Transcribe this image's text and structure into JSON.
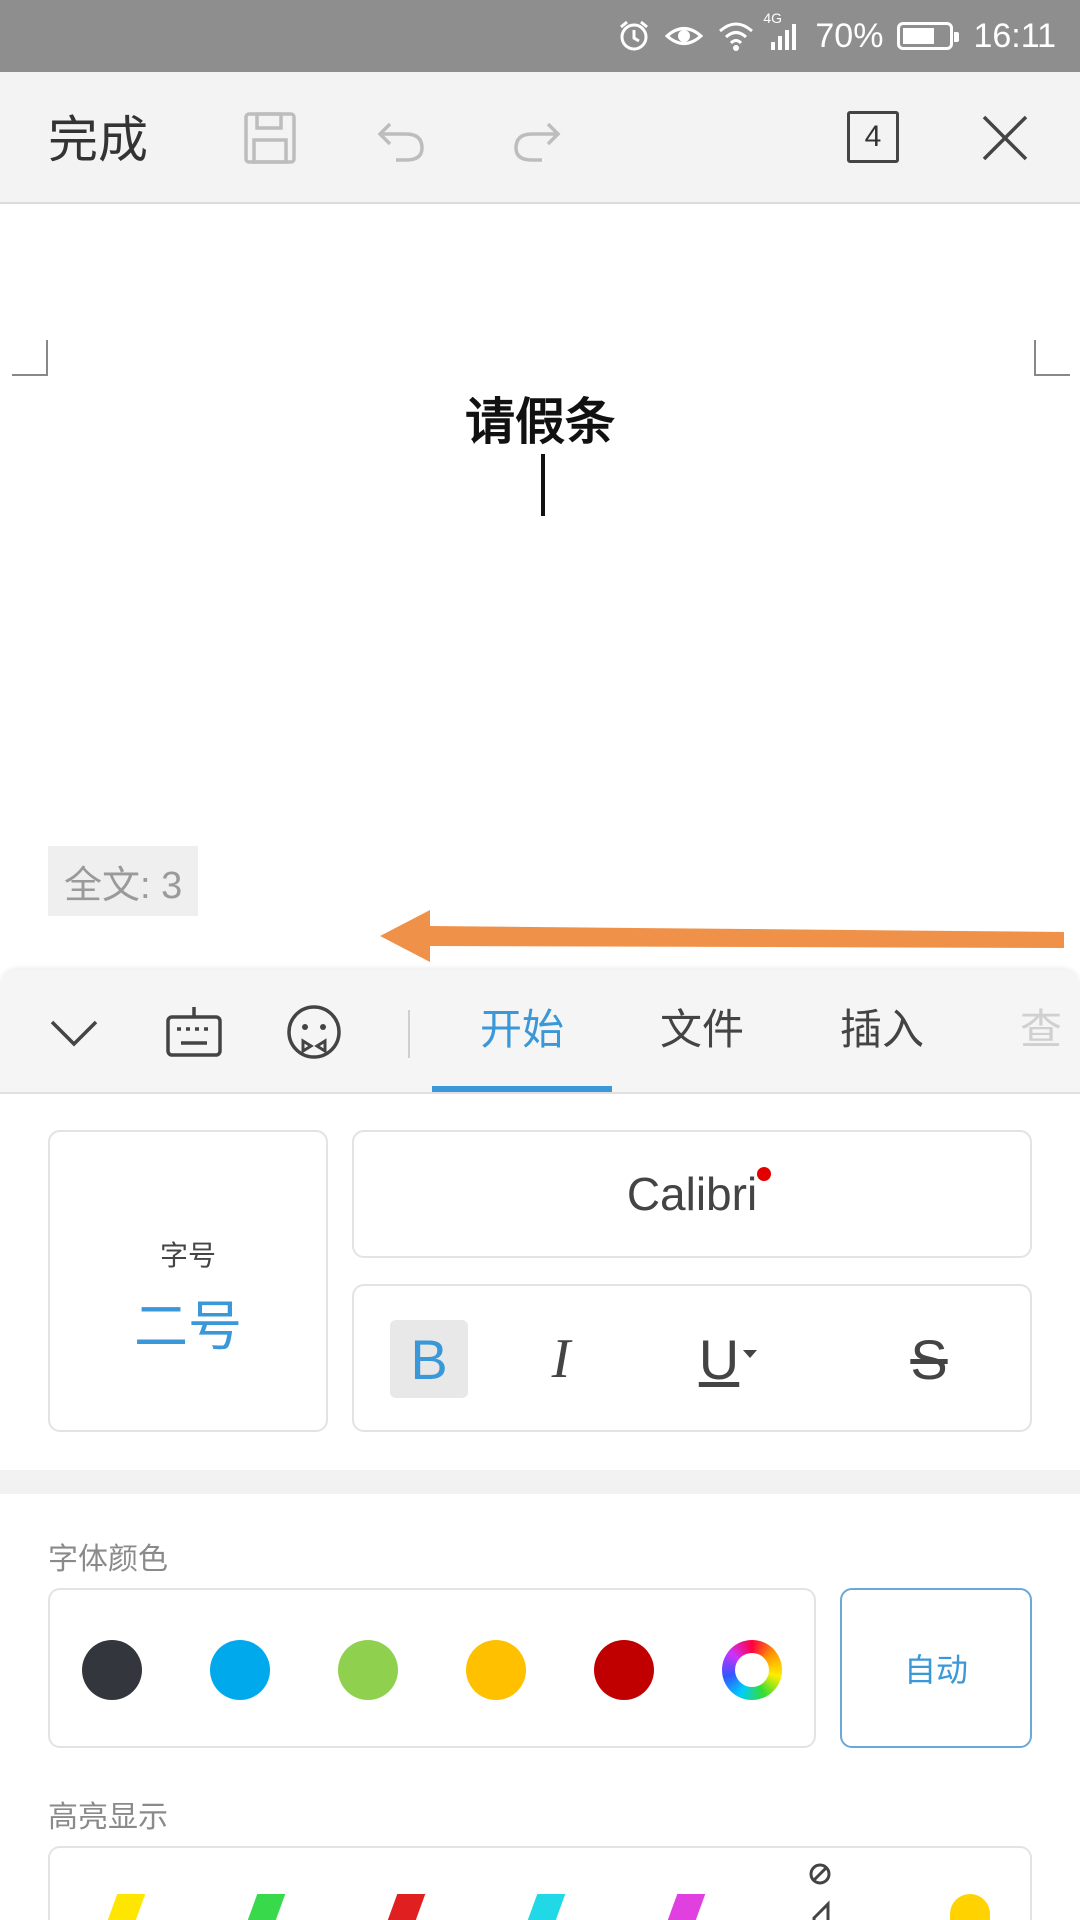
{
  "status_bar": {
    "battery": "70%",
    "battery_level": 0.7,
    "time": "16:11",
    "network": "4G",
    "icons": [
      "alarm-icon",
      "eye-icon",
      "wifi-icon",
      "signal-icon",
      "battery-icon"
    ]
  },
  "toolbar": {
    "done_label": "完成",
    "page_count": "4",
    "icons": [
      "save-icon",
      "undo-icon",
      "redo-icon",
      "close-icon"
    ]
  },
  "document": {
    "title": "请假条",
    "word_count": "全文: 3"
  },
  "panel": {
    "icons": [
      "collapse-icon",
      "keyboard-icon",
      "emoji-icon"
    ],
    "tabs": [
      {
        "label": "开始",
        "active": true
      },
      {
        "label": "文件",
        "active": false
      },
      {
        "label": "插入",
        "active": false
      },
      {
        "label": "查",
        "active": false
      }
    ],
    "font_size_label": "字号",
    "font_size_value": "二号",
    "font_name": "Calibri",
    "style_buttons": {
      "bold": "B",
      "italic": "I",
      "underline": "U",
      "strike": "S"
    },
    "font_color_label": "字体颜色",
    "font_colors": [
      "#33363d",
      "#00a9ec",
      "#8fd14f",
      "#ffc000",
      "#c00000"
    ],
    "auto_label": "自动",
    "highlight_label": "高亮显示",
    "highlight_colors": [
      "#ffe600",
      "#38d94a",
      "#e02020",
      "#20d8e6",
      "#e040e0",
      "#444444",
      "#ffd200"
    ]
  },
  "accent_color": "#3a98d8",
  "arrow_color": "#f0914a"
}
